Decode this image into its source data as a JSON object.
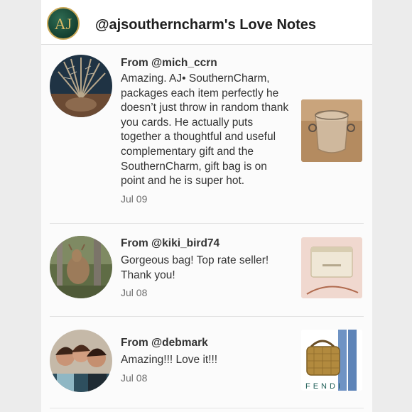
{
  "header": {
    "logo_text": "AJ",
    "title": "@ajsoutherncharm's Love Notes"
  },
  "notes": [
    {
      "from": "From @mich_ccrn",
      "text": "Amazing. AJ• SouthernCharm, packages each item perfectly he doesn’t just throw in random thank you cards. He actually puts together a thoughtful and useful complementary gift and the SouthernCharm, gift bag is on point and he is super hot.",
      "date": "Jul 09",
      "avatar_icon": "palm-leaves-photo",
      "thumb_icon": "glass-jar-photo"
    },
    {
      "from": "From @kiki_bird74",
      "text": "Gorgeous bag! Top rate seller! Thank you!",
      "date": "Jul 08",
      "avatar_icon": "deer-photo",
      "thumb_icon": "cream-handbag-photo"
    },
    {
      "from": "From @debmark",
      "text": "Amazing!!! Love it!!!",
      "date": "Jul 08",
      "avatar_icon": "group-selfie-photo",
      "thumb_icon": "fendi-bag-photo",
      "thumb_brand": "FENDI"
    }
  ],
  "colors": {
    "text": "#333333",
    "muted": "#6d6d6d",
    "divider": "#e3e3e3",
    "logo_green": "#134030",
    "logo_gold": "#c9a857"
  }
}
